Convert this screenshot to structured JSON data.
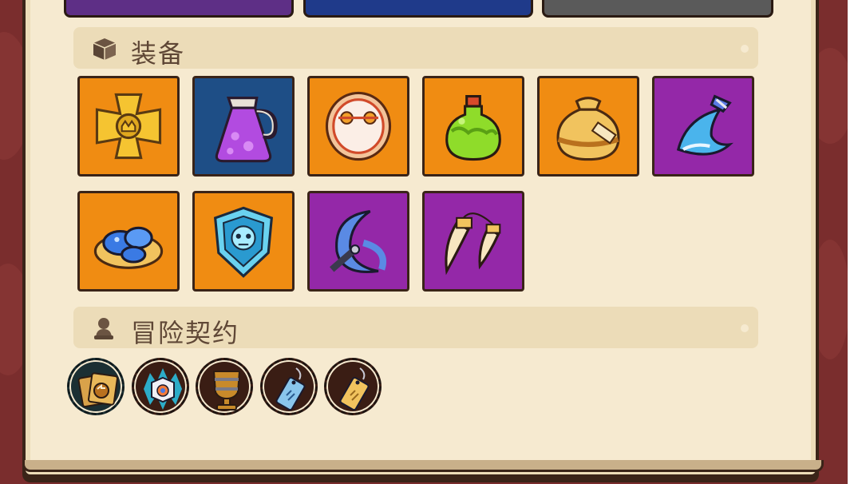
{
  "equipment": {
    "title": "装备",
    "icon": "cube-icon",
    "items": [
      {
        "name": "golden-cross-amulet-icon",
        "rarity": "orange"
      },
      {
        "name": "purple-potion-jug-icon",
        "rarity": "blue"
      },
      {
        "name": "eye-ring-icon",
        "rarity": "orange"
      },
      {
        "name": "green-poison-flask-icon",
        "rarity": "orange"
      },
      {
        "name": "loot-sack-icon",
        "rarity": "orange"
      },
      {
        "name": "ice-claw-blade-icon",
        "rarity": "purple"
      },
      {
        "name": "blue-slime-egg-icon",
        "rarity": "orange"
      },
      {
        "name": "skull-shield-icon",
        "rarity": "orange"
      },
      {
        "name": "crescent-blade-icon",
        "rarity": "purple"
      },
      {
        "name": "fang-pair-icon",
        "rarity": "purple"
      }
    ]
  },
  "adventure_contract": {
    "title": "冒险契约",
    "icon": "adventurer-bust-icon",
    "items": [
      {
        "name": "swap-cards-icon",
        "selected": true
      },
      {
        "name": "electric-cube-icon",
        "selected": false
      },
      {
        "name": "golden-goblet-icon",
        "selected": false
      },
      {
        "name": "blue-talisman-tag-icon",
        "selected": false
      },
      {
        "name": "gold-talisman-tag-icon",
        "selected": false
      }
    ]
  },
  "colors": {
    "orange": "#f08c12",
    "blue": "#1e4e86",
    "purple": "#9428a8",
    "parchment": "#f6ead0",
    "header": "#ecdcb8",
    "outline": "#3a2418"
  }
}
